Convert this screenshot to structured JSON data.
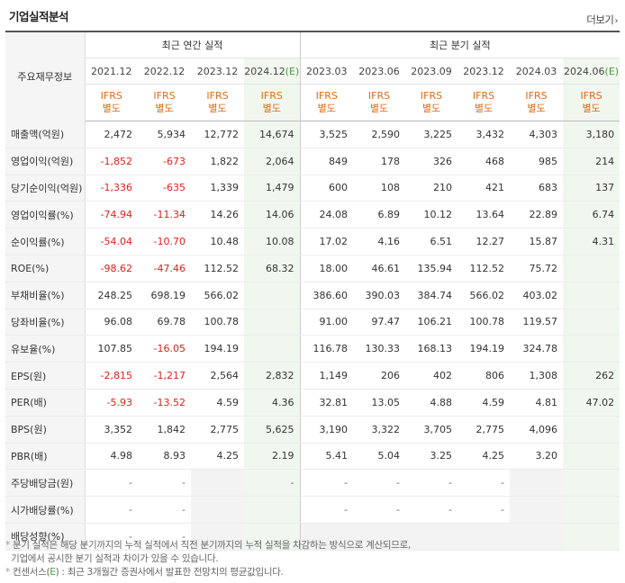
{
  "title": "기업실적분석",
  "more_label": "더보기",
  "header": {
    "corner": "주요재무정보",
    "annual_group": "최근 연간 실적",
    "quarter_group": "최근 분기 실적",
    "annual_periods": [
      "2021.12",
      "2022.12",
      "2023.12",
      "2024.12"
    ],
    "quarter_periods": [
      "2023.03",
      "2023.06",
      "2023.09",
      "2023.12",
      "2024.03",
      "2024.06"
    ],
    "estimate_mark": "(E)",
    "ifrs_top": "IFRS",
    "ifrs_bottom": "별도"
  },
  "rows": [
    {
      "label": "매출액(억원)",
      "values": [
        "2,472",
        "5,934",
        "12,772",
        "14,674",
        "3,525",
        "2,590",
        "3,225",
        "3,432",
        "4,303",
        "3,180"
      ]
    },
    {
      "label": "영업이익(억원)",
      "values": [
        "-1,852",
        "-673",
        "1,822",
        "2,064",
        "849",
        "178",
        "326",
        "468",
        "985",
        "214"
      ]
    },
    {
      "label": "당기순이익(억원)",
      "values": [
        "-1,336",
        "-635",
        "1,339",
        "1,479",
        "600",
        "108",
        "210",
        "421",
        "683",
        "137"
      ]
    },
    {
      "label": "영업이익률(%)",
      "values": [
        "-74.94",
        "-11.34",
        "14.26",
        "14.06",
        "24.08",
        "6.89",
        "10.12",
        "13.64",
        "22.89",
        "6.74"
      ]
    },
    {
      "label": "순이익률(%)",
      "values": [
        "-54.04",
        "-10.70",
        "10.48",
        "10.08",
        "17.02",
        "4.16",
        "6.51",
        "12.27",
        "15.87",
        "4.31"
      ]
    },
    {
      "label": "ROE(%)",
      "values": [
        "-98.62",
        "-47.46",
        "112.52",
        "68.32",
        "18.00",
        "46.61",
        "135.94",
        "112.52",
        "75.72",
        ""
      ]
    },
    {
      "label": "부채비율(%)",
      "values": [
        "248.25",
        "698.19",
        "566.02",
        "",
        "386.60",
        "390.03",
        "384.74",
        "566.02",
        "403.02",
        ""
      ]
    },
    {
      "label": "당좌비율(%)",
      "values": [
        "96.08",
        "69.78",
        "100.78",
        "",
        "91.00",
        "97.47",
        "106.21",
        "100.78",
        "119.57",
        ""
      ]
    },
    {
      "label": "유보율(%)",
      "values": [
        "107.85",
        "-16.05",
        "194.19",
        "",
        "116.78",
        "130.33",
        "168.13",
        "194.19",
        "324.78",
        ""
      ]
    },
    {
      "label": "EPS(원)",
      "values": [
        "-2,815",
        "-1,217",
        "2,564",
        "2,832",
        "1,149",
        "206",
        "402",
        "806",
        "1,308",
        "262"
      ]
    },
    {
      "label": "PER(배)",
      "values": [
        "-5.93",
        "-13.52",
        "4.59",
        "4.36",
        "32.81",
        "13.05",
        "4.88",
        "4.59",
        "4.81",
        "47.02"
      ]
    },
    {
      "label": "BPS(원)",
      "values": [
        "3,352",
        "1,842",
        "2,775",
        "5,625",
        "3,190",
        "3,322",
        "3,705",
        "2,775",
        "4,096",
        ""
      ]
    },
    {
      "label": "PBR(배)",
      "values": [
        "4.98",
        "8.93",
        "4.25",
        "2.19",
        "5.41",
        "5.04",
        "3.25",
        "4.25",
        "3.20",
        ""
      ]
    },
    {
      "label": "주당배당금(원)",
      "values": [
        "-",
        "-",
        "",
        "-",
        "-",
        "-",
        "-",
        "-",
        "",
        ""
      ]
    },
    {
      "label": "시가배당률(%)",
      "values": [
        "-",
        "-",
        "",
        "",
        "-",
        "-",
        "-",
        "-",
        "",
        ""
      ]
    },
    {
      "label": "배당성향(%)",
      "values": [
        "-",
        "-",
        "",
        "",
        "",
        "",
        "",
        "",
        "",
        ""
      ]
    }
  ],
  "notes": {
    "line1": "분기 실적은 해당 분기까지의 누적 실적에서 직전 분기까지의 누적 실적을 차감하는 방식으로 계산되므로,",
    "line2": "기업에서 공시한 분기 실적과 차이가 있을 수 있습니다.",
    "line3_prefix": "컨센서스(",
    "line3_e": "E",
    "line3_suffix": ") : 최근 3개월간 증권사에서 발표한 전망치의 평균값입니다.",
    "star": "*"
  },
  "colors": {
    "negative": "#e0201b",
    "ifrs": "#e06a13",
    "estimate_bg": "#f1f7ef",
    "estimate_text": "#4a9a3f"
  }
}
